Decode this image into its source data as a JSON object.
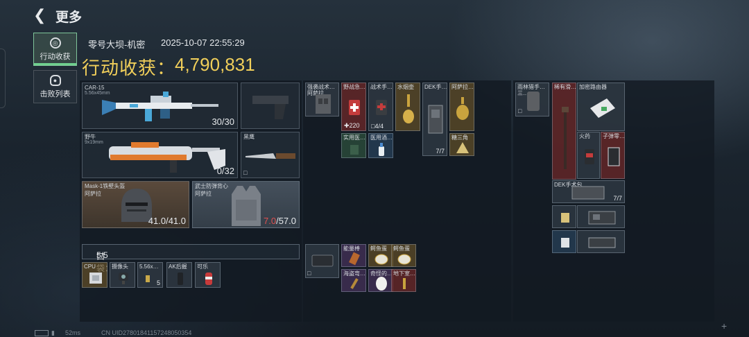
{
  "header": {
    "back_icon": "back-arrow-icon",
    "title": "更多"
  },
  "nav": {
    "tabs": [
      {
        "label": "行动收获",
        "icon": "loot-icon",
        "active": true
      },
      {
        "label": "击败列表",
        "icon": "skull-icon",
        "active": false
      }
    ]
  },
  "summary": {
    "map": "零号大坝-机密",
    "datetime": "2025-10-07 22:55:29",
    "earnings_label": "行动收获：",
    "earnings_value": "4,790,831",
    "accent_color": "#f1cf5a"
  },
  "equipment": {
    "primary": {
      "name": "CAR-15",
      "caliber": "5.56x45mm",
      "ammo": "30/30"
    },
    "pistol": {
      "name": ""
    },
    "secondary": {
      "name": "野牛",
      "caliber": "9x19mm",
      "ammo": "0/32"
    },
    "melee": {
      "name": "黑鹰"
    },
    "helmet": {
      "name": "Mask-1铁壁头盔",
      "brand": "阿萨拉",
      "durability": "41.0/41.0"
    },
    "armor": {
      "name": "武士防弹背心",
      "brand": "阿萨拉",
      "durability_current": "7.0",
      "durability_max": "/57.0"
    }
  },
  "pocket": {
    "label": "口袋：",
    "count": "5/5",
    "items": [
      {
        "name": "CPU",
        "qty": ""
      },
      {
        "name": "摄像头",
        "qty": ""
      },
      {
        "name": "5.56x…",
        "qty": "5"
      },
      {
        "name": "AK后握",
        "qty": ""
      },
      {
        "name": "可乐",
        "qty": ""
      }
    ]
  },
  "rig": {
    "items": [
      {
        "name": "强袭战术…",
        "sub": "阿萨拉"
      }
    ]
  },
  "backpack_a": {
    "items": [
      {
        "name": "野战急…",
        "qty": "220"
      },
      {
        "name": "战术手…",
        "qty": "4/4"
      },
      {
        "name": "水烟壶",
        "qty": ""
      },
      {
        "name": "DEK手…",
        "qty": "7/7"
      },
      {
        "name": "阿萨拉…",
        "qty": ""
      },
      {
        "name": "实用医…",
        "qty": ""
      },
      {
        "name": "医用酒…",
        "qty": ""
      },
      {
        "name": "糖三角",
        "qty": ""
      },
      {
        "name": "能量棒",
        "qty": ""
      },
      {
        "name": "鳄鱼蛋",
        "qty": ""
      },
      {
        "name": "鳄鱼蛋",
        "qty": ""
      },
      {
        "name": "海盗弯…",
        "qty": ""
      },
      {
        "name": "奇怪的…",
        "qty": ""
      },
      {
        "name": "地下室…",
        "qty": ""
      }
    ]
  },
  "backpack_b": {
    "items": [
      {
        "name": "雨林猎手…",
        "sub": "三…"
      },
      {
        "name": "稀有滑…",
        "qty": ""
      },
      {
        "name": "加密路由器",
        "qty": ""
      },
      {
        "name": "火药",
        "qty": ""
      },
      {
        "name": "子弹零…",
        "qty": ""
      },
      {
        "name": "DEK手术包",
        "qty": "7/7"
      }
    ]
  },
  "footer": {
    "ping": "52ms",
    "uid": "CN UID27801841157248050354"
  }
}
